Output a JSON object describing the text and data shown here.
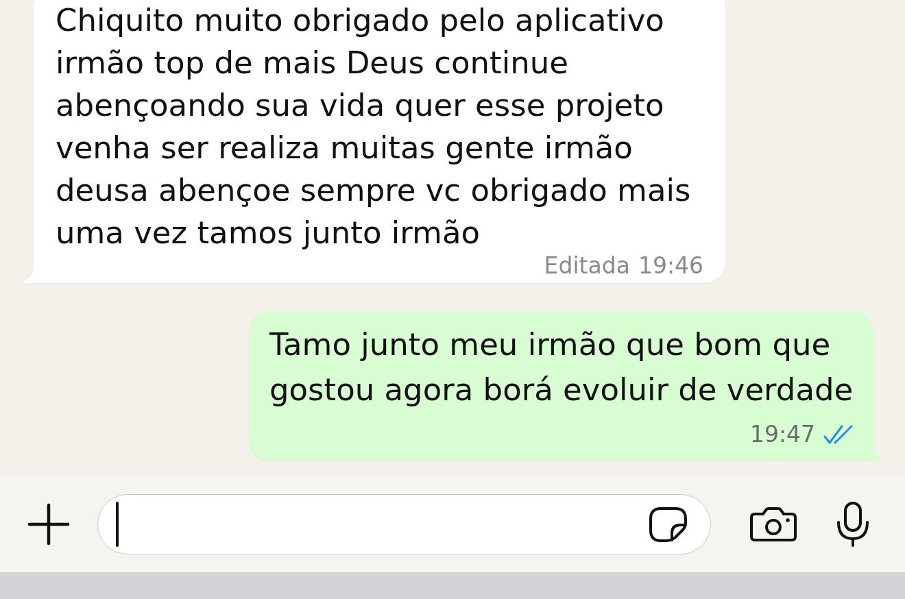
{
  "messages": [
    {
      "kind": "received",
      "text": "Chiquito muito obrigado pelo aplicativo irmão top de mais Deus continue abençoando sua vida quer esse projeto venha ser realiza muitas gente irmão deusa abençoe sempre vc obrigado mais uma vez tamos junto irmão",
      "edited_label": "Editada",
      "time": "19:46"
    },
    {
      "kind": "sent",
      "text": "Tamo junto meu irmão que bom que gostou agora borá evoluir de verdade",
      "time": "19:47",
      "read": true
    }
  ],
  "composer": {
    "focused": true
  }
}
